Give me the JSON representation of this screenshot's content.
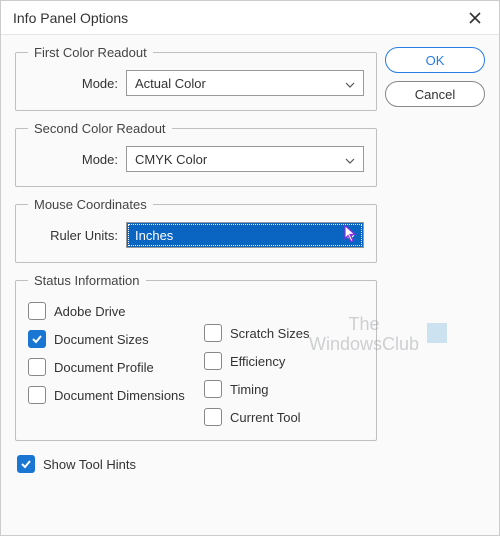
{
  "title": "Info Panel Options",
  "buttons": {
    "ok": "OK",
    "cancel": "Cancel"
  },
  "first_readout": {
    "legend": "First Color Readout",
    "mode_label": "Mode:",
    "value": "Actual Color"
  },
  "second_readout": {
    "legend": "Second Color Readout",
    "mode_label": "Mode:",
    "value": "CMYK Color"
  },
  "mouse": {
    "legend": "Mouse Coordinates",
    "ruler_label": "Ruler Units:",
    "value": "Inches"
  },
  "status": {
    "legend": "Status Information",
    "items_col1": [
      {
        "label": "Adobe Drive",
        "checked": false
      },
      {
        "label": "Document Sizes",
        "checked": true
      },
      {
        "label": "Document Profile",
        "checked": false
      },
      {
        "label": "Document Dimensions",
        "checked": false
      }
    ],
    "items_col2": [
      {
        "label": "Scratch Sizes",
        "checked": false
      },
      {
        "label": "Efficiency",
        "checked": false
      },
      {
        "label": "Timing",
        "checked": false
      },
      {
        "label": "Current Tool",
        "checked": false
      }
    ]
  },
  "show_hints": {
    "label": "Show Tool Hints",
    "checked": true
  },
  "watermark": {
    "line1": "The",
    "line2": "WindowsClub"
  }
}
